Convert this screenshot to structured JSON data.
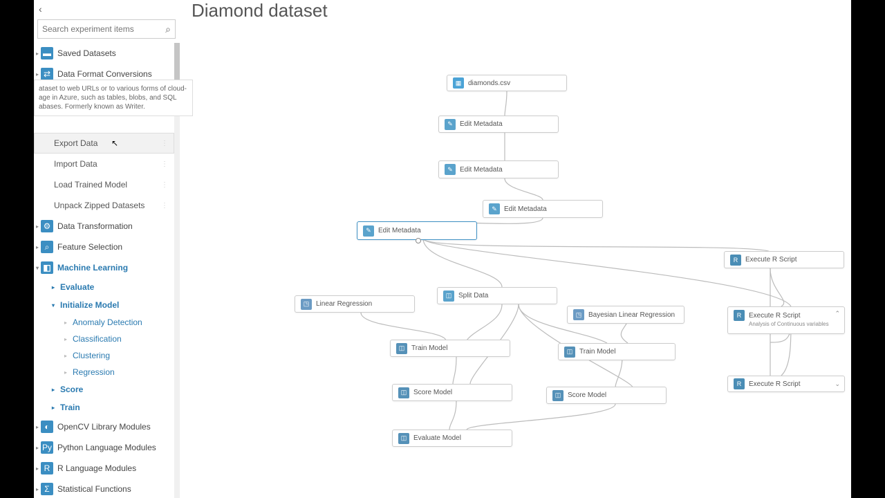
{
  "title": "Diamond dataset",
  "search": {
    "placeholder": "Search experiment items"
  },
  "tooltip": "ataset to web URLs or to various forms of cloud-age in Azure, such as tables, blobs, and SQL abases. Formerly known as Writer.",
  "sidebar": {
    "cats": [
      {
        "label": "Saved Datasets"
      },
      {
        "label": "Data Format Conversions"
      },
      {
        "label": "Data Transformation"
      },
      {
        "label": "Feature Selection"
      },
      {
        "label": "Machine Learning"
      },
      {
        "label": "OpenCV Library Modules"
      },
      {
        "label": "Python Language Modules"
      },
      {
        "label": "R Language Modules"
      },
      {
        "label": "Statistical Functions"
      }
    ],
    "mods": [
      {
        "label": "Export Data"
      },
      {
        "label": "Import Data"
      },
      {
        "label": "Load Trained Model"
      },
      {
        "label": "Unpack Zipped Datasets"
      }
    ],
    "ml_subs": [
      {
        "label": "Evaluate"
      },
      {
        "label": "Initialize Model"
      },
      {
        "label": "Score"
      },
      {
        "label": "Train"
      }
    ],
    "init_subs": [
      {
        "label": "Anomaly Detection"
      },
      {
        "label": "Classification"
      },
      {
        "label": "Clustering"
      },
      {
        "label": "Regression"
      }
    ]
  },
  "nodes": {
    "n1": "diamonds.csv",
    "n2": "Edit Metadata",
    "n3": "Edit Metadata",
    "n4": "Edit Metadata",
    "n5": "Edit Metadata",
    "n6": "Split Data",
    "n7": "Linear Regression",
    "n8": "Bayesian Linear Regression",
    "n9": "Train Model",
    "n10": "Train Model",
    "n11": "Score Model",
    "n12": "Score Model",
    "n13": "Evaluate Model",
    "n14": "Execute R Script",
    "n15": "Execute R Script",
    "n15sub": "Analysis of Continuous variables",
    "n16": "Execute R Script"
  }
}
